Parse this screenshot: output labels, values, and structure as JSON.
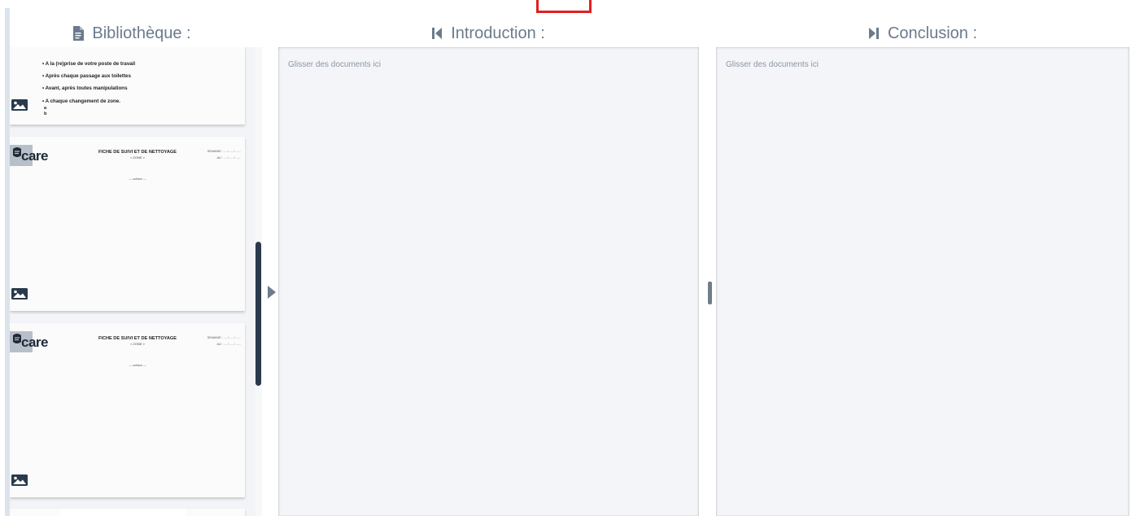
{
  "columns": {
    "library": {
      "title": "Bibliothèque :",
      "icon": "document-icon"
    },
    "introduction": {
      "title": "Introduction :",
      "icon": "skip-previous-icon",
      "drop_hint": "Glisser des documents ici"
    },
    "conclusion": {
      "title": "Conclusion :",
      "icon": "skip-next-icon",
      "drop_hint": "Glisser des documents ici"
    }
  },
  "library_docs": [
    {
      "bullets": [
        "• A la (re)prise de votre poste de travail",
        "• Après chaque passage aux toilettes",
        "• Avant, après toutes manipulations",
        "• A chaque changement de zone."
      ],
      "sub_lines": [
        "a",
        "b"
      ],
      "icon": "image-icon"
    },
    {
      "logo": "care",
      "title": "FICHE DE SUIVI ET DE NETTOYAGE",
      "subtitle": "« ZONE »",
      "week_line_1": "SEMAINE : .... / .... / ......",
      "week_line_2": "AU : .... / .... / ......",
      "center_text": "— surface —",
      "icon": "image-icon"
    },
    {
      "logo": "care",
      "title": "FICHE DE SUIVI ET DE NETTOYAGE",
      "subtitle": "« ZONE »",
      "week_line_1": "SEMAINE : .... / .... / ......",
      "week_line_2": "AU : .... / .... / ......",
      "center_text": "— surface —",
      "icon": "image-icon"
    }
  ],
  "colors": {
    "header_text": "#6b7b8d",
    "drop_zone_bg": "#f4f5f8",
    "splitter_handle": "#2a3a4c",
    "accent_red": "#e02020"
  }
}
